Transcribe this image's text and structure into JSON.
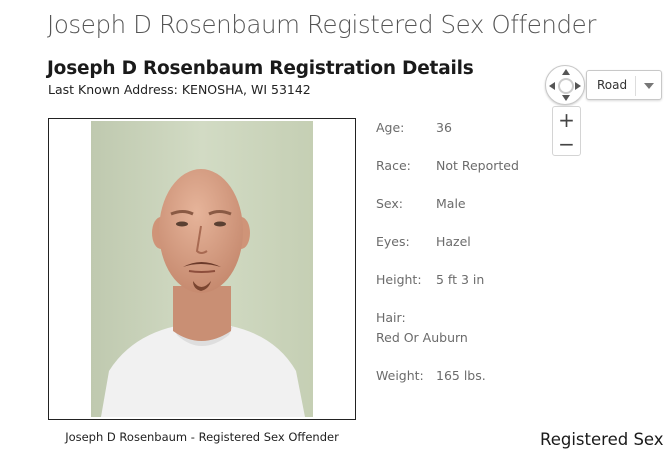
{
  "page": {
    "title": "Joseph D Rosenbaum Registered Sex Offender"
  },
  "registration": {
    "heading": "Joseph D Rosenbaum Registration Details",
    "address": "Last Known Address: KENOSHA, WI 53142"
  },
  "photo": {
    "caption": "Joseph D Rosenbaum - Registered Sex Offender"
  },
  "details": [
    {
      "label": "Age:",
      "value": "36"
    },
    {
      "label": "Race:",
      "value": "Not Reported"
    },
    {
      "label": "Sex:",
      "value": "Male"
    },
    {
      "label": "Eyes:",
      "value": "Hazel"
    },
    {
      "label": "Height:",
      "value": "5 ft 3 in"
    },
    {
      "label": "Hair:",
      "value": "Red Or Auburn"
    },
    {
      "label": "Weight:",
      "value": "165 lbs."
    }
  ],
  "map": {
    "type_label": "Road",
    "zoom_in": "+",
    "zoom_out": "−"
  },
  "footer": {
    "heading": "Registered Sex"
  },
  "icons": {
    "nav": "pan-compass-icon",
    "caret": "chevron-down-icon"
  },
  "colors": {
    "photo_background": "#c8d2b8",
    "skin": "#d9a58a",
    "shirt": "#f2f2f2"
  }
}
